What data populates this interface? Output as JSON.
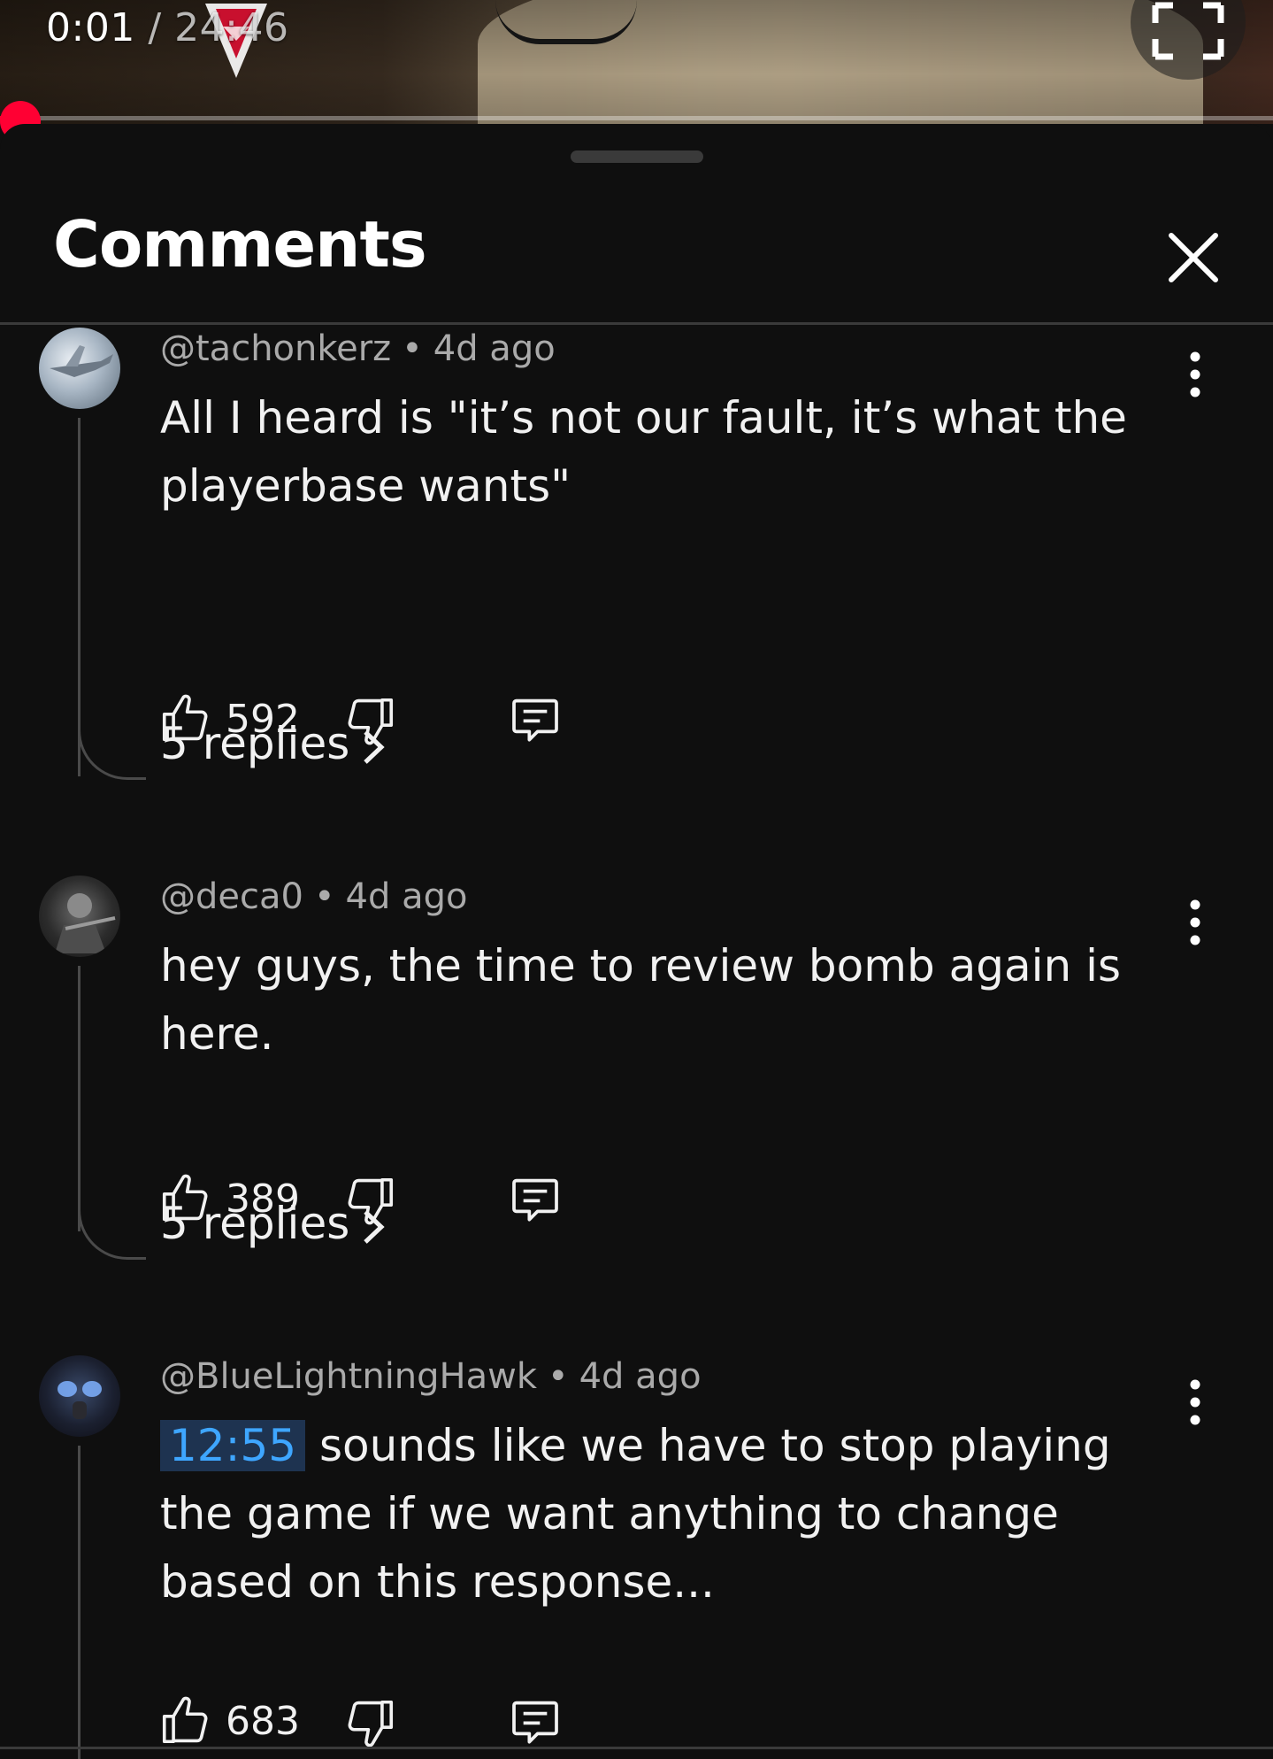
{
  "player": {
    "current_time": "0:01",
    "separator": "/",
    "duration": "24:46",
    "progress_fraction": 0.0007
  },
  "sheet": {
    "title": "Comments",
    "close_icon": "close-icon"
  },
  "comments": [
    {
      "handle": "@tachonkerz",
      "dot": "•",
      "age": "4d ago",
      "text": "All I heard is \"it’s not our fault, it’s what the playerbase wants\"",
      "likes": "592",
      "replies": "5 replies"
    },
    {
      "handle": "@deca0",
      "dot": "•",
      "age": "4d ago",
      "text": "hey guys, the time to review bomb again is here.",
      "likes": "389",
      "replies": "5 replies"
    },
    {
      "handle": "@BlueLightningHawk",
      "dot": "•",
      "age": "4d ago",
      "timestamp": "12:55",
      "text": "sounds like we have to stop playing the game if we want anything to change based on this response...",
      "likes": "683"
    }
  ],
  "colors": {
    "background": "#0f0f0f",
    "progress": "#ff0033",
    "link": "#3ea6ff",
    "link_bg": "#1e3350",
    "secondary_text": "#aaaaaa"
  }
}
